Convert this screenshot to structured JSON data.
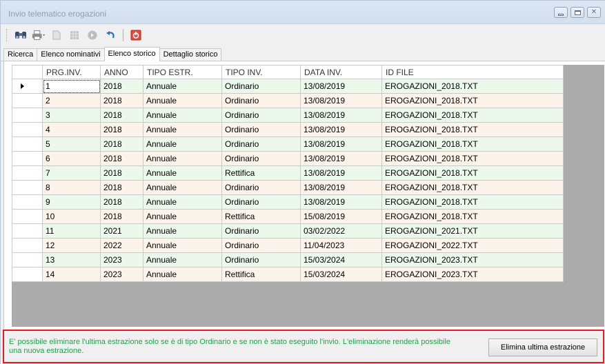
{
  "window": {
    "title": "Invio telematico erogazioni",
    "controls": [
      "minimize",
      "maximize",
      "close"
    ]
  },
  "toolbar": {
    "icons": [
      "binoculars-icon",
      "printer-icon",
      "document-icon",
      "grid-icon",
      "forward-icon",
      "undo-icon",
      "exit-icon"
    ]
  },
  "tabs": [
    {
      "label": "Ricerca",
      "active": false
    },
    {
      "label": "Elenco nominativi",
      "active": false
    },
    {
      "label": "Elenco storico",
      "active": true
    },
    {
      "label": "Dettaglio storico",
      "active": false
    }
  ],
  "grid": {
    "columns": [
      "PRG.INV.",
      "ANNO",
      "TIPO ESTR.",
      "TIPO INV.",
      "DATA INV.",
      "ID FILE"
    ],
    "current_row": 0,
    "rows": [
      [
        "1",
        "2018",
        "Annuale",
        "Ordinario",
        "13/08/2019",
        "EROGAZIONI_2018.TXT"
      ],
      [
        "2",
        "2018",
        "Annuale",
        "Ordinario",
        "13/08/2019",
        "EROGAZIONI_2018.TXT"
      ],
      [
        "3",
        "2018",
        "Annuale",
        "Ordinario",
        "13/08/2019",
        "EROGAZIONI_2018.TXT"
      ],
      [
        "4",
        "2018",
        "Annuale",
        "Ordinario",
        "13/08/2019",
        "EROGAZIONI_2018.TXT"
      ],
      [
        "5",
        "2018",
        "Annuale",
        "Ordinario",
        "13/08/2019",
        "EROGAZIONI_2018.TXT"
      ],
      [
        "6",
        "2018",
        "Annuale",
        "Ordinario",
        "13/08/2019",
        "EROGAZIONI_2018.TXT"
      ],
      [
        "7",
        "2018",
        "Annuale",
        "Rettifica",
        "13/08/2019",
        "EROGAZIONI_2018.TXT"
      ],
      [
        "8",
        "2018",
        "Annuale",
        "Ordinario",
        "13/08/2019",
        "EROGAZIONI_2018.TXT"
      ],
      [
        "9",
        "2018",
        "Annuale",
        "Ordinario",
        "13/08/2019",
        "EROGAZIONI_2018.TXT"
      ],
      [
        "10",
        "2018",
        "Annuale",
        "Rettifica",
        "15/08/2019",
        "EROGAZIONI_2018.TXT"
      ],
      [
        "11",
        "2021",
        "Annuale",
        "Ordinario",
        "03/02/2022",
        "EROGAZIONI_2021.TXT"
      ],
      [
        "12",
        "2022",
        "Annuale",
        "Ordinario",
        "11/04/2023",
        "EROGAZIONI_2022.TXT"
      ],
      [
        "13",
        "2023",
        "Annuale",
        "Ordinario",
        "15/03/2024",
        "EROGAZIONI_2023.TXT"
      ],
      [
        "14",
        "2023",
        "Annuale",
        "Rettifica",
        "15/03/2024",
        "EROGAZIONI_2023.TXT"
      ]
    ]
  },
  "status": {
    "message": "E' possibile eliminare l'ultima estrazione solo se è di tipo Ordinario e se non è stato eseguito l'invio. L'eliminazione renderà possibile una nuova estrazione.",
    "button_label": "Elimina ultima estrazione"
  },
  "colors": {
    "row_even": "#ecf8ec",
    "row_odd": "#fcf4ea",
    "status_text": "#18a84a",
    "highlight_border": "#e31c23",
    "grid_background": "#ababab"
  }
}
